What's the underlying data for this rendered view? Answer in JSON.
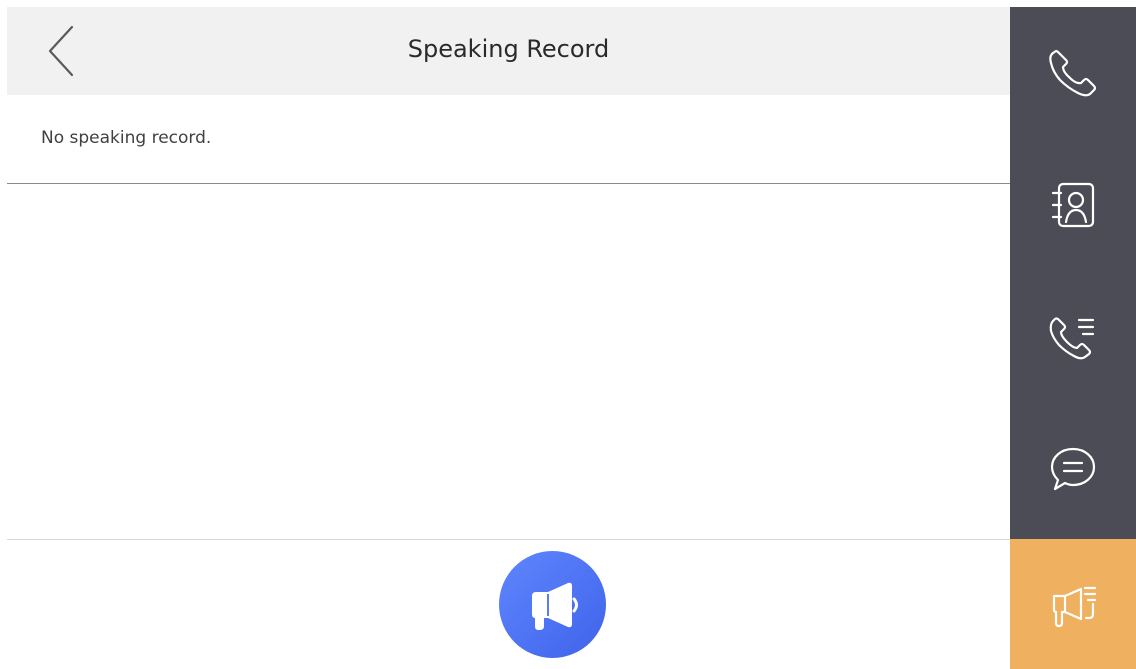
{
  "header": {
    "title": "Speaking Record",
    "back_icon": "chevron-left-icon"
  },
  "main": {
    "empty_message": "No speaking record.",
    "speak_button_icon": "megaphone-icon"
  },
  "sidebar": {
    "items": [
      {
        "name": "call",
        "icon": "phone-icon",
        "active": false
      },
      {
        "name": "contacts",
        "icon": "contact-book-icon",
        "active": false
      },
      {
        "name": "call-log",
        "icon": "call-log-icon",
        "active": false
      },
      {
        "name": "messages",
        "icon": "message-bubble-icon",
        "active": false
      },
      {
        "name": "speaking-record",
        "icon": "megaphone-list-icon",
        "active": true
      }
    ]
  },
  "colors": {
    "sidebar": "#4b4c56",
    "active": "#efb15f",
    "header": "#f1f1f1",
    "button": "#5274f4"
  }
}
